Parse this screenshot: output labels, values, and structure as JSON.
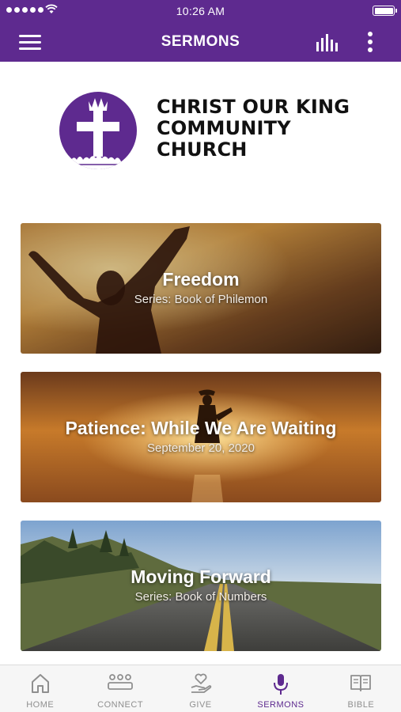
{
  "status_bar": {
    "time": "10:26 AM",
    "signal_icon": "signal-dots-icon",
    "wifi_icon": "wifi-icon",
    "battery_icon": "battery-icon",
    "battery_level": 1.0
  },
  "app_bar": {
    "title": "SERMONS",
    "menu_icon": "hamburger-menu-icon",
    "audio_icon": "audio-bars-icon",
    "more_icon": "more-vertical-icon",
    "background_color": "#5e2a8f"
  },
  "church": {
    "name_lines": [
      "CHRIST OUR KING",
      "COMMUNITY",
      "CHURCH"
    ],
    "logo_icon": "crowned-cross-logo-icon"
  },
  "sermons": [
    {
      "title": "Freedom",
      "subtitle": "Series: Book of Philemon",
      "image": "silhouette-raised-arms-sunset"
    },
    {
      "title": "Patience: While We Are Waiting",
      "subtitle": "September 20, 2020",
      "image": "figure-walking-golden-water"
    },
    {
      "title": "Moving Forward",
      "subtitle": "Series: Book of Numbers",
      "image": "open-road-horizon"
    }
  ],
  "tabs": [
    {
      "label": "HOME",
      "icon": "home-icon",
      "active": false
    },
    {
      "label": "CONNECT",
      "icon": "people-group-icon",
      "active": false
    },
    {
      "label": "GIVE",
      "icon": "hand-heart-icon",
      "active": false
    },
    {
      "label": "SERMONS",
      "icon": "microphone-icon",
      "active": true
    },
    {
      "label": "BIBLE",
      "icon": "open-book-icon",
      "active": false
    }
  ],
  "colors": {
    "brand_purple": "#5e2a8f",
    "tab_inactive": "#8f8f8f",
    "tab_bar_bg": "#f6f6f6"
  }
}
